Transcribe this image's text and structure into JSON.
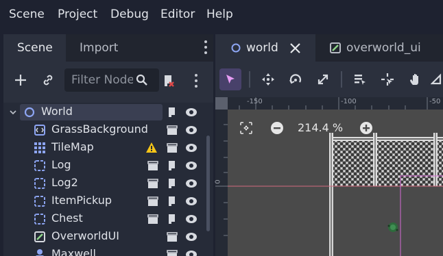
{
  "menu": [
    "Scene",
    "Project",
    "Debug",
    "Editor",
    "Help"
  ],
  "dock": {
    "tabs": [
      {
        "label": "Scene",
        "active": true
      },
      {
        "label": "Import",
        "active": false
      }
    ],
    "filter_placeholder": "Filter Nodes",
    "tree": [
      {
        "label": "World",
        "icon": "node2d-icon",
        "selected": true,
        "expandable": true
      },
      {
        "label": "GrassBackground",
        "icon": "sprite-icon"
      },
      {
        "label": "TileMap",
        "icon": "tilemap-icon",
        "warning": true
      },
      {
        "label": "Log",
        "icon": "instance-icon"
      },
      {
        "label": "Log2",
        "icon": "instance-icon"
      },
      {
        "label": "ItemPickup",
        "icon": "instance-icon"
      },
      {
        "label": "Chest",
        "icon": "instance-icon"
      },
      {
        "label": "OverworldUI",
        "icon": "control-icon"
      },
      {
        "label": "Maxwell",
        "icon": "character-icon"
      }
    ]
  },
  "editor": {
    "tabs": [
      {
        "label": "world",
        "active": true
      },
      {
        "label": "overworld_ui",
        "active": false
      }
    ],
    "zoom": "214.4 %",
    "ruler_x": [
      "-150",
      "-100",
      "-50"
    ],
    "ruler_y": [
      "0"
    ]
  },
  "colors": {
    "accent": "#6e8fff",
    "select_tool": "#48416a",
    "warning": "#f5c518"
  }
}
